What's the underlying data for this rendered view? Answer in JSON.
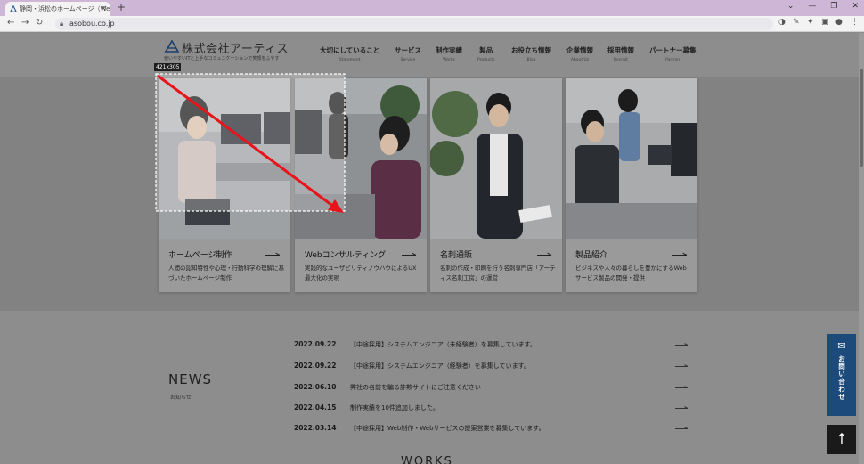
{
  "browser": {
    "tab_title": "静岡・浜松のホームページ（Webサイ",
    "tab_close": "×",
    "new_tab": "+",
    "url": "asobou.co.jp",
    "window_controls": [
      "⌄",
      "—",
      "❐",
      "✕"
    ]
  },
  "site": {
    "logo_name": "株式会社アーティス",
    "tagline": "使いやすいITと上手なコミュニケーションで笑顔をふやす",
    "nav": [
      {
        "jp": "大切にしていること",
        "en": "Statement"
      },
      {
        "jp": "サービス",
        "en": "Service"
      },
      {
        "jp": "制作実績",
        "en": "Works"
      },
      {
        "jp": "製品",
        "en": "Products"
      },
      {
        "jp": "お役立ち情報",
        "en": "Blog"
      },
      {
        "jp": "企業情報",
        "en": "About Us"
      },
      {
        "jp": "採用情報",
        "en": "Recruit"
      },
      {
        "jp": "パートナー募集",
        "en": "Partner"
      }
    ]
  },
  "selection_size": "421x305",
  "cards": [
    {
      "title": "ホームページ制作",
      "desc": "人間の認知特性や心理・行動科学の理解に基づいたホームページ制作"
    },
    {
      "title": "Webコンサルティング",
      "desc": "実践的なユーザビリティノウハウによるUX最大化の実現"
    },
    {
      "title": "名刺通販",
      "desc": "名刺の作成・印刷を行う名刺専門店「アーティス名刺工房」の運営"
    },
    {
      "title": "製品紹介",
      "desc": "ビジネスや人々の暮らしを豊かにするWebサービス製品の開発・提供"
    }
  ],
  "news": {
    "heading": "NEWS",
    "sub": "お知らせ",
    "items": [
      {
        "date": "2022.09.22",
        "text": "【中途採用】システムエンジニア（未経験者）を募集しています。"
      },
      {
        "date": "2022.09.22",
        "text": "【中途採用】システムエンジニア（経験者）を募集しています。"
      },
      {
        "date": "2022.06.10",
        "text": "弊社の名前を騙る詐欺サイトにご注意ください"
      },
      {
        "date": "2022.04.15",
        "text": "制作実績を10件追加しました。"
      },
      {
        "date": "2022.03.14",
        "text": "【中途採用】Web制作・Webサービスの提案営業を募集しています。"
      }
    ]
  },
  "works_heading": "WORKS",
  "contact_label": "お問い合わせ",
  "to_top": "↑",
  "colors": {
    "accent_blue": "#1c4a7b",
    "annotation_red": "#e8141b"
  }
}
